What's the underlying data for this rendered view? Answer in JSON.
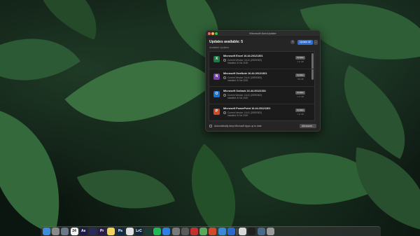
{
  "window": {
    "title": "Microsoft AutoUpdate",
    "heading": "Updates available: 5",
    "available_label": "Available Updates",
    "help_icon": "?",
    "update_all_label": "Update All",
    "more_icon": "...",
    "auto_update_label": "Automatically keep Microsoft Apps up to date",
    "advanced_label": "Advanced..."
  },
  "updates": [
    {
      "name": "Microsoft Excel 16.44.20121301",
      "version": "Current Version: 16.41 (20090302)",
      "installed": "Installed: 8 Oct 2020",
      "update_label": "Update",
      "size": "1.11 GB",
      "icon": "excel-icon",
      "icon_char": "X",
      "color": "#1f7a45"
    },
    {
      "name": "Microsoft OneNote 16.44.20121301",
      "version": "Current Version: 16.41 (20090302)",
      "installed": "Installed: 8 Oct 2020",
      "update_label": "Update",
      "size": "758 MB",
      "icon": "onenote-icon",
      "icon_char": "N",
      "color": "#7a3db8"
    },
    {
      "name": "Microsoft Outlook 16.44.20121301",
      "version": "Current Version: 16.41 (20090302)",
      "installed": "Installed: 8 Oct 2020",
      "update_label": "Update",
      "size": "1.17 GB",
      "icon": "outlook-icon",
      "icon_char": "O",
      "color": "#1a6fc9"
    },
    {
      "name": "Microsoft PowerPoint 16.44.20121301",
      "version": "Current Version: 16.41 (20090302)",
      "installed": "Installed: 8 Oct 2020",
      "update_label": "Update",
      "size": "1.11 GB",
      "icon": "powerpoint-icon",
      "icon_char": "P",
      "color": "#d14b22"
    }
  ],
  "dock": {
    "apps": [
      {
        "name": "finder-icon",
        "label": "",
        "color": "#3b8de0"
      },
      {
        "name": "launchpad-icon",
        "label": "",
        "color": "#8a8a8a"
      },
      {
        "name": "files-icon",
        "label": "",
        "color": "#6a7a8a"
      },
      {
        "name": "calendar-icon",
        "label": "24",
        "color": "#f2f2f2"
      },
      {
        "name": "after-effects-icon",
        "label": "Ae",
        "color": "#1d1b4a"
      },
      {
        "name": "media-encoder-icon",
        "label": "",
        "color": "#2a2a5a"
      },
      {
        "name": "premiere-icon",
        "label": "Pr",
        "color": "#2a1a4a"
      },
      {
        "name": "notes-icon",
        "label": "",
        "color": "#f2d45a"
      },
      {
        "name": "photoshop-icon",
        "label": "Ps",
        "color": "#0e2a4a"
      },
      {
        "name": "chrome-icon",
        "label": "",
        "color": "#e0e0e0"
      },
      {
        "name": "lightroom-classic-icon",
        "label": "LrC",
        "color": "#0f2540"
      },
      {
        "name": "audition-icon",
        "label": "",
        "color": "#1c3a36"
      },
      {
        "name": "spotify-icon",
        "label": "",
        "color": "#1db954"
      },
      {
        "name": "app-store-icon",
        "label": "",
        "color": "#2f7fe0"
      },
      {
        "name": "system-preferences-icon",
        "label": "",
        "color": "#7a7a7a"
      },
      {
        "name": "settings-icon",
        "label": "",
        "color": "#5a5a5a"
      },
      {
        "name": "pdf-icon",
        "label": "",
        "color": "#c43030"
      },
      {
        "name": "maps-icon",
        "label": "",
        "color": "#5aa85a"
      },
      {
        "name": "office-icon",
        "label": "",
        "color": "#d04a2a"
      },
      {
        "name": "safari-icon",
        "label": "",
        "color": "#3a8ad8"
      },
      {
        "name": "autoupdate-icon",
        "label": "",
        "color": "#2a6ad0"
      },
      {
        "name": "preview-icon",
        "label": "",
        "color": "#d8d8d8"
      },
      {
        "name": "terminal-icon",
        "label": "",
        "color": "#202020"
      },
      {
        "name": "downloads-icon",
        "label": "",
        "color": "#4a6a8a"
      },
      {
        "name": "trash-icon",
        "label": "",
        "color": "#9a9a9a"
      }
    ]
  }
}
